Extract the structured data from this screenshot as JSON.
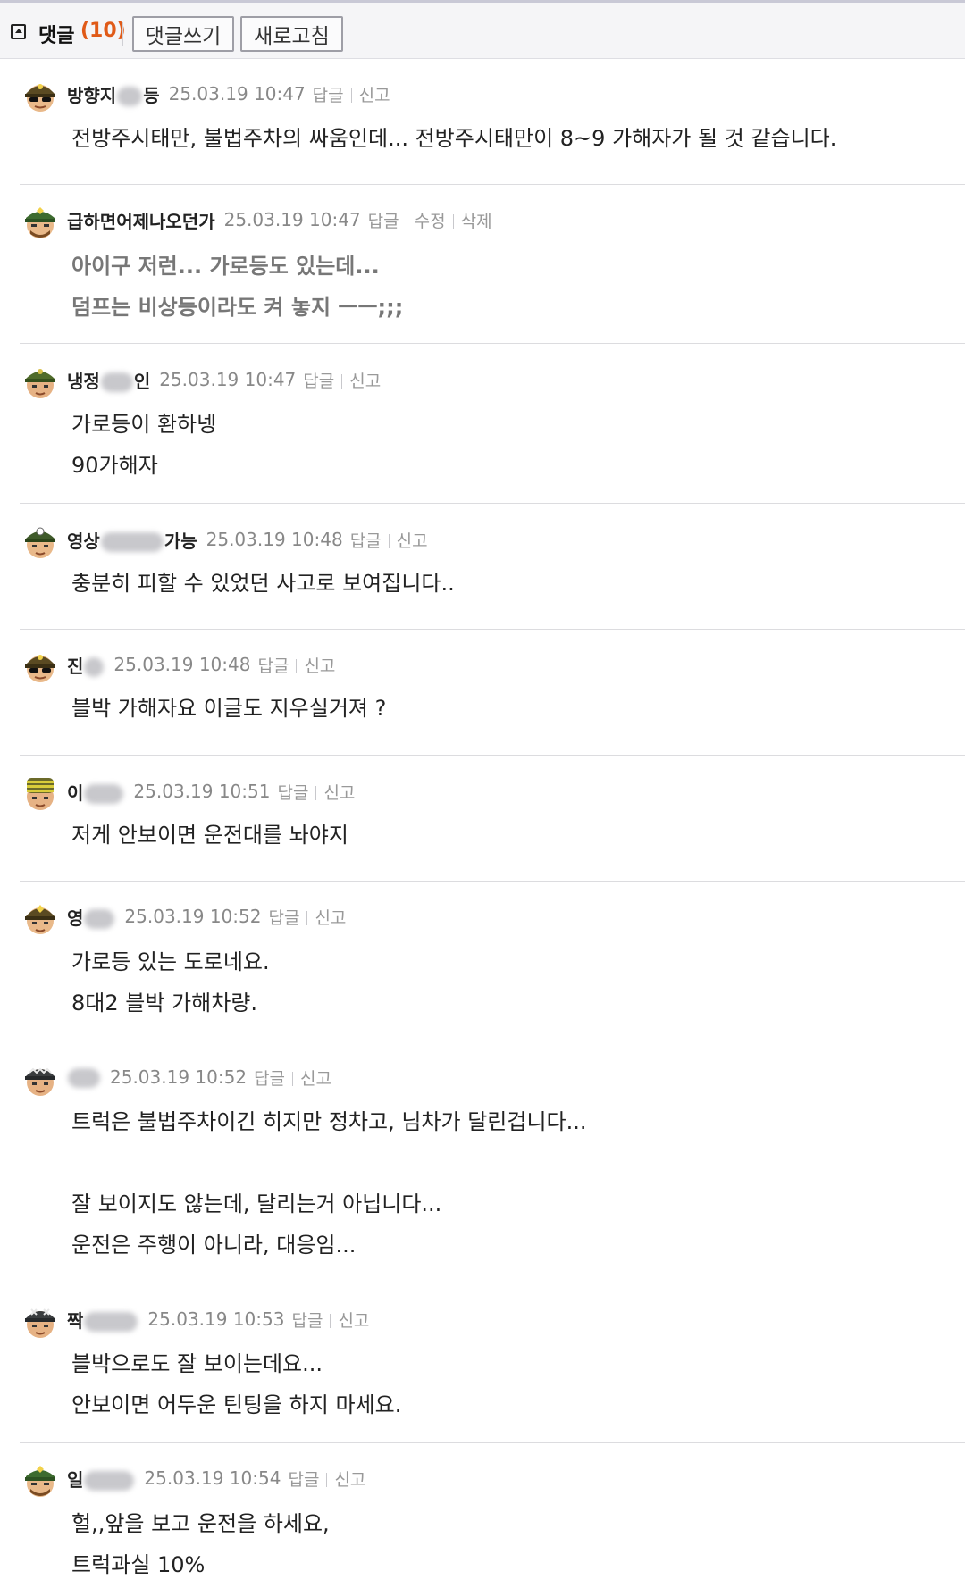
{
  "toolbar": {
    "label": "댓글",
    "count": "(10)",
    "write_button": "댓글쓰기",
    "refresh_button": "새로고침"
  },
  "actions": {
    "reply": "답글",
    "report": "신고",
    "edit": "수정",
    "delete": "삭제"
  },
  "comments": [
    {
      "nick_start": "방향지",
      "nick_end": "등",
      "timestamp": "25.03.19 10:47",
      "lines": [
        "전방주시태만, 불법주차의 싸움인데... 전방주시태만이 8~9 가해자가 될 것 같습니다."
      ]
    },
    {
      "nick_start": "급하면어제나오던가",
      "nick_end": "",
      "timestamp": "25.03.19 10:47",
      "lines": [
        "아이구 저런... 가로등도 있는데...",
        "덤프는 비상등이라도 켜 놓지 ㅡㅡ;;;"
      ]
    },
    {
      "nick_start": "냉정",
      "nick_end": "인",
      "timestamp": "25.03.19 10:47",
      "lines": [
        "가로등이 환하넹",
        "90가해자"
      ]
    },
    {
      "nick_start": "영상",
      "nick_end": "가능",
      "timestamp": "25.03.19 10:48",
      "lines": [
        "충분히 피할 수 있었던 사고로 보여집니다.."
      ]
    },
    {
      "nick_start": "진",
      "nick_end": "",
      "timestamp": "25.03.19 10:48",
      "lines": [
        "블박 가해자요 이글도 지우실거져 ?"
      ]
    },
    {
      "nick_start": "이",
      "nick_end": "",
      "timestamp": "25.03.19 10:51",
      "lines": [
        "저게 안보이면 운전대를 놔야지"
      ]
    },
    {
      "nick_start": "영",
      "nick_end": "",
      "timestamp": "25.03.19 10:52",
      "lines": [
        "가로등 있는 도로네요.",
        "8대2 블박 가해차량."
      ]
    },
    {
      "nick_start": "",
      "nick_end": "",
      "timestamp": "25.03.19 10:52",
      "lines": [
        "트럭은 불법주차이긴 히지만 정차고, 님차가 달린겁니다...",
        "",
        "잘 보이지도 않는데, 달리는거 아닙니다...",
        "운전은 주행이 아니라, 대응임..."
      ]
    },
    {
      "nick_start": "짝",
      "nick_end": "",
      "timestamp": "25.03.19 10:53",
      "lines": [
        "블박으로도 잘 보이는데요...",
        "안보이면 어두운 틴팅을 하지 마세요."
      ]
    },
    {
      "nick_start": "일",
      "nick_end": "",
      "timestamp": "25.03.19 10:54",
      "lines": [
        "헐,,앞을 보고 운전을 하세요,",
        "트럭과실 10%"
      ]
    }
  ]
}
